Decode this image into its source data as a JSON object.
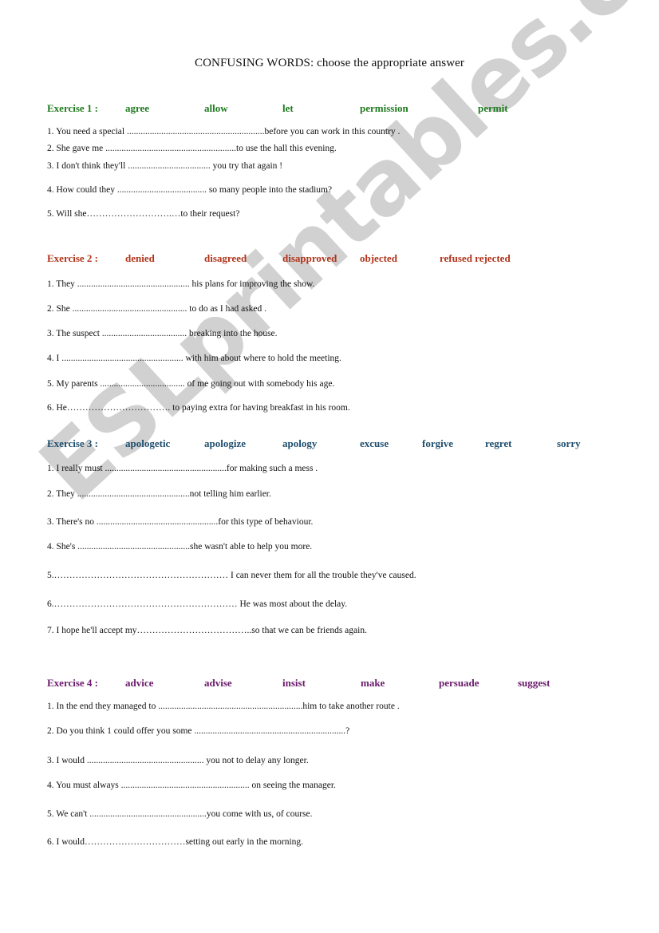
{
  "document": {
    "title": "CONFUSING WORDS: choose the appropriate answer",
    "watermark": "ESLprintables.com"
  },
  "exercises": [
    {
      "label": "Exercise 1 :",
      "color": "#1e7a1e",
      "words": [
        "agree",
        "allow",
        "let",
        "permission",
        "permit"
      ],
      "sentences": [
        "1. You need a special ............................................................before you can work in this country .",
        "2. She gave me .........................................................to use the hall this evening.",
        "3. I don't think they'll .................................... you try that again !",
        "4. How could they ....................................... so many people into the stadium?",
        "5. Will she……………………….…to their request?"
      ]
    },
    {
      "label": "Exercise 2 :",
      "color": "#b0331a",
      "words": [
        "denied",
        "disagreed",
        "disapproved",
        "objected",
        "refused rejected"
      ],
      "sentences": [
        "1. They ................................................. his plans for improving the show.",
        "2.  She .................................................. to do as I had asked .",
        "3.  The suspect ..................................... breaking into the house.",
        "4.   I   ..................................................... with him about where to hold the meeting.",
        "5.  My  parents  ..................................... of me going out with somebody his age.",
        "6. He……………………………. to paying extra for having breakfast in his room."
      ]
    },
    {
      "label": "Exercise 3 :",
      "color": "#1f4e6e",
      "words": [
        "apologetic",
        "apologize",
        "apology",
        "excuse",
        "forgive",
        "regret",
        "sorry"
      ],
      "sentences": [
        "1. I really must .....................................................for making such a mess .",
        "2. They .................................................not telling him earlier.",
        "3. There's no  .....................................................for this type of behaviour.",
        "4. She's  .................................................she wasn't able to help you more.",
        "5.………………………………………………… I can never them for all the trouble they've caused.",
        "6.……………………………………………………  He was most         about the delay.",
        "7. I hope he'll accept my………………………………..so that we can be friends again."
      ]
    },
    {
      "label": "Exercise 4 :",
      "color": "#6a1a6a",
      "words": [
        "advice",
        "advise",
        "insist",
        "make",
        "persuade",
        "suggest"
      ],
      "sentences": [
        "1. In the end they managed to  ...............................................................him to take another route .",
        "2.  Do you think 1 could offer you some  ..................................................................?",
        "3. I would ................................................... you not to delay any longer.",
        "4. You must always ........................................................ on seeing the manager.",
        "5. We can't  ...................................................you come with us, of course.",
        "6. I would……………………………setting out early in the morning."
      ]
    }
  ]
}
